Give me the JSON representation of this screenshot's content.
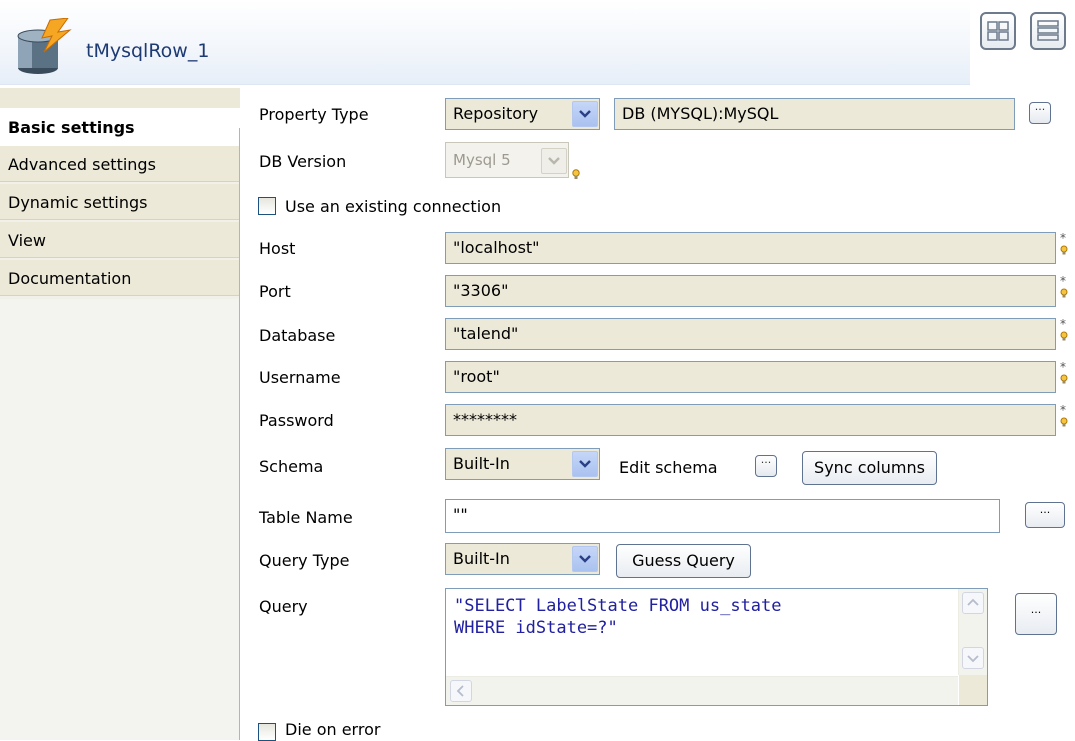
{
  "header": {
    "title": "tMysqlRow_1",
    "icons": [
      "mysql-component-icon",
      "grid-layout-icon",
      "list-layout-icon"
    ]
  },
  "sidebar": {
    "items": [
      {
        "label": "Basic settings",
        "active": true
      },
      {
        "label": "Advanced settings",
        "active": false
      },
      {
        "label": "Dynamic settings",
        "active": false
      },
      {
        "label": "View",
        "active": false
      },
      {
        "label": "Documentation",
        "active": false
      }
    ]
  },
  "form": {
    "property_type": {
      "label": "Property Type",
      "value": "Repository",
      "repository_value": "DB (MYSQL):MySQL"
    },
    "db_version": {
      "label": "DB Version",
      "value": "Mysql 5"
    },
    "use_existing_connection": {
      "label": "Use an existing connection",
      "checked": false
    },
    "host": {
      "label": "Host",
      "value": "\"localhost\""
    },
    "port": {
      "label": "Port",
      "value": "\"3306\""
    },
    "database": {
      "label": "Database",
      "value": "\"talend\""
    },
    "username": {
      "label": "Username",
      "value": "\"root\""
    },
    "password": {
      "label": "Password",
      "value": "********"
    },
    "schema": {
      "label": "Schema",
      "value": "Built-In",
      "edit_label": "Edit schema",
      "sync_label": "Sync columns"
    },
    "table_name": {
      "label": "Table Name",
      "value": "\"\""
    },
    "query_type": {
      "label": "Query Type",
      "value": "Built-In",
      "guess_label": "Guess Query"
    },
    "query": {
      "label": "Query",
      "line1": "\"SELECT LabelState FROM us_state",
      "line2": "WHERE idState=?\""
    },
    "die_on_error": {
      "label": "Die on error",
      "checked": false
    }
  },
  "colors": {
    "title": "#1e3a73",
    "keyword": "#2020a0",
    "field_bg": "#ece9d8",
    "border": "#7f9db9"
  }
}
